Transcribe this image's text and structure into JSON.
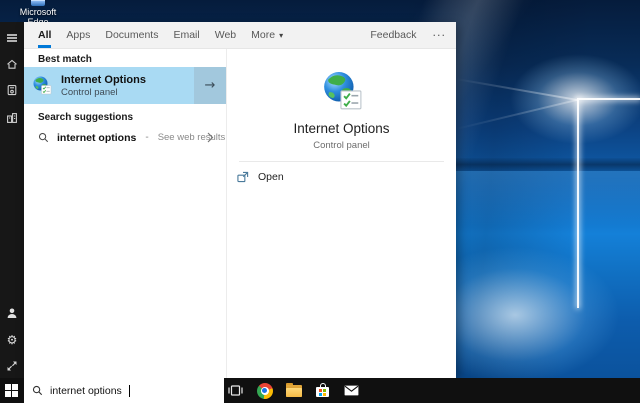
{
  "desktop": {
    "edge_icon_label_1": "Microsoft",
    "edge_icon_label_2": "Edge"
  },
  "search_panel": {
    "tabs": {
      "all": "All",
      "apps": "Apps",
      "documents": "Documents",
      "email": "Email",
      "web": "Web",
      "more": "More"
    },
    "feedback_label": "Feedback",
    "results": {
      "best_match_label": "Best match",
      "best_match_title": "Internet Options",
      "best_match_subtitle": "Control panel",
      "suggestions_label": "Search suggestions",
      "suggestion_query": "internet options",
      "suggestion_separator": "-",
      "suggestion_hint": "See web results"
    },
    "preview": {
      "title": "Internet Options",
      "subtitle": "Control panel",
      "open_label": "Open"
    }
  },
  "sidebar": {
    "icons": [
      "hamburger-menu",
      "home",
      "notebook",
      "organization",
      "account",
      "settings-gear",
      "feedback-arrows"
    ]
  },
  "taskbar": {
    "search_value": "internet options",
    "icons": [
      "task-view",
      "chrome",
      "file-explorer",
      "microsoft-store",
      "mail"
    ]
  },
  "glyphs": {
    "more_caret": "▾",
    "ellipsis": "···",
    "best_match_arrow": "→",
    "gear": "⚙"
  },
  "colors": {
    "accent": "#0078d7",
    "best_match_highlight": "#a9daf3",
    "best_match_arrow_box": "#a2c8dd",
    "sidebar_bg": "#171717",
    "taskbar_bg": "#101010"
  }
}
